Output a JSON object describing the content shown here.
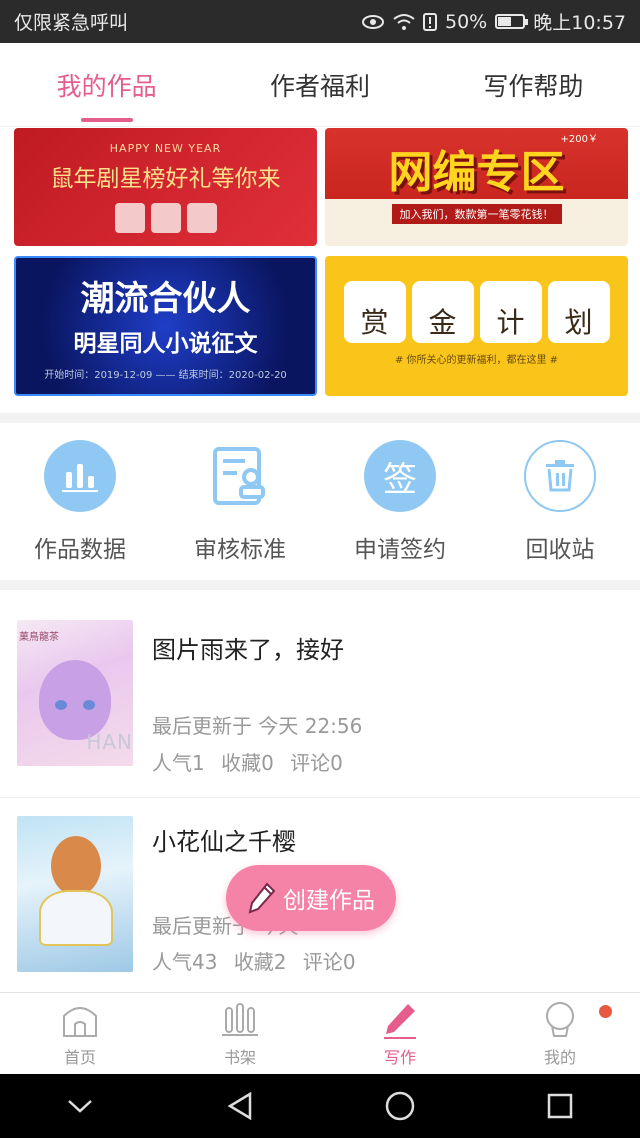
{
  "status_bar": {
    "carrier": "仅限紧急呼叫",
    "battery": "50%",
    "battery_level": 0.5,
    "time": "晚上10:57"
  },
  "tabs": [
    {
      "label": "我的作品",
      "active": true
    },
    {
      "label": "作者福利",
      "active": false
    },
    {
      "label": "写作帮助",
      "active": false
    }
  ],
  "banners": {
    "b1": {
      "small": "HAPPY NEW YEAR",
      "large": "鼠年剧星榜好礼等你来"
    },
    "b2": {
      "corner": "+200￥",
      "large": "网编专区",
      "small": "加入我们，数款第一笔零花钱！"
    },
    "b3": {
      "large": "潮流合伙人",
      "medium": "明星同人小说征文",
      "small": "开始时间：2019-12-09 —— 结束时间：2020-02-20"
    },
    "b4": {
      "chars": [
        "赏",
        "金",
        "计",
        "划"
      ],
      "small": "# 你所关心的更新福利，都在这里 #"
    }
  },
  "actions": [
    {
      "label": "作品数据",
      "icon": "bar-chart-icon"
    },
    {
      "label": "审核标准",
      "icon": "review-doc-icon"
    },
    {
      "label": "申请签约",
      "icon": "sign-icon",
      "glyph": "签"
    },
    {
      "label": "回收站",
      "icon": "trash-icon"
    }
  ],
  "works": [
    {
      "title": "图片雨来了，接好",
      "updated": "最后更新于 今天 22:56",
      "stats": [
        "人气1",
        "收藏0",
        "评论0"
      ],
      "cover_tag": "菓鳥龍茶",
      "cover_text": "HAN"
    },
    {
      "title": "小花仙之千樱",
      "updated": "最后更新于 今天",
      "stats": [
        "人气43",
        "收藏2",
        "评论0"
      ]
    }
  ],
  "fab": {
    "label": "创建作品"
  },
  "bottom_nav": [
    {
      "label": "首页",
      "icon": "home-icon"
    },
    {
      "label": "书架",
      "icon": "bookshelf-icon"
    },
    {
      "label": "写作",
      "icon": "pencil-icon",
      "active": true
    },
    {
      "label": "我的",
      "icon": "profile-icon",
      "badge": true
    }
  ],
  "colors": {
    "accent": "#e45d8c",
    "fab": "#f583a8",
    "icon_blue": "#8fc8f2"
  }
}
